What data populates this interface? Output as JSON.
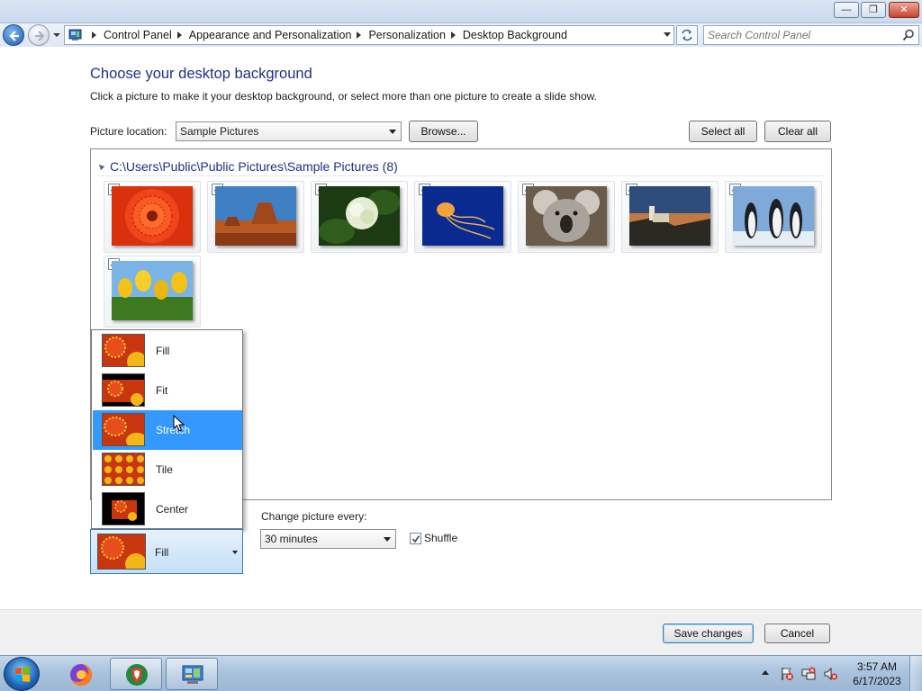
{
  "window": {
    "minimize_label": "—",
    "maximize_label": "❐",
    "close_label": "✕"
  },
  "address": {
    "crumbs": [
      "Control Panel",
      "Appearance and Personalization",
      "Personalization",
      "Desktop Background"
    ],
    "search_placeholder": "Search Control Panel"
  },
  "header": {
    "title": "Choose your desktop background",
    "subtitle": "Click a picture to make it your desktop background, or select more than one picture to create a slide show."
  },
  "location": {
    "label": "Picture location:",
    "value": "Sample Pictures",
    "browse_label": "Browse...",
    "select_all_label": "Select all",
    "clear_all_label": "Clear all"
  },
  "gallery": {
    "group_title": "C:\\Users\\Public\\Public Pictures\\Sample Pictures (8)",
    "pictures": [
      {
        "name": "chrysanthemum",
        "checked": true
      },
      {
        "name": "desert",
        "checked": true
      },
      {
        "name": "hydrangeas",
        "checked": true
      },
      {
        "name": "jellyfish",
        "checked": true
      },
      {
        "name": "koala",
        "checked": true
      },
      {
        "name": "lighthouse",
        "checked": true
      },
      {
        "name": "penguins",
        "checked": true
      },
      {
        "name": "tulips",
        "checked": true
      }
    ]
  },
  "position": {
    "label_current": "Fill",
    "options": [
      "Fill",
      "Fit",
      "Stretch",
      "Tile",
      "Center"
    ],
    "highlighted": "Stretch"
  },
  "slideshow": {
    "interval_label": "Change picture every:",
    "interval_value": "30 minutes",
    "shuffle_label": "Shuffle",
    "shuffle_checked": true
  },
  "actions": {
    "save_label": "Save changes",
    "cancel_label": "Cancel"
  },
  "taskbar": {
    "pinned": [
      "firefox-icon",
      "vpn-shield-icon",
      "control-panel-icon"
    ],
    "time": "3:57 AM",
    "date": "6/17/2023"
  },
  "colors": {
    "title_blue": "#1e3287",
    "selection_blue": "#3399ff"
  }
}
